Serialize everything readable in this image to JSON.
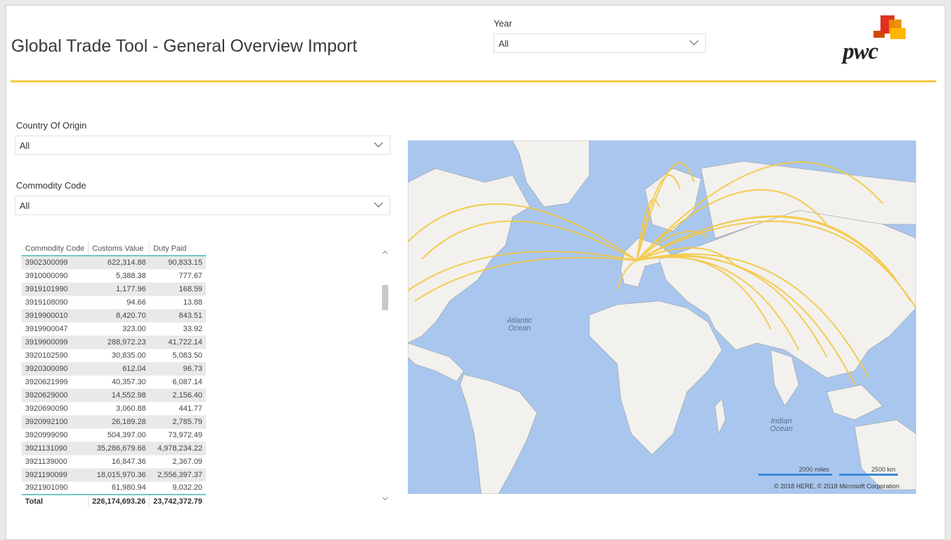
{
  "header": {
    "title": "Global Trade Tool - General Overview Import",
    "logo_text": "pwc"
  },
  "filters": {
    "year": {
      "label": "Year",
      "value": "All"
    },
    "country": {
      "label": "Country Of Origin",
      "value": "All"
    },
    "commodity": {
      "label": "Commodity Code",
      "value": "All"
    }
  },
  "table": {
    "columns": [
      "Commodity Code",
      "Customs Value",
      "Duty Paid"
    ],
    "rows": [
      [
        "3902300099",
        "622,314.88",
        "90,833.15"
      ],
      [
        "3910000090",
        "5,388.38",
        "777.67"
      ],
      [
        "3919101990",
        "1,177.96",
        "168.59"
      ],
      [
        "3919108090",
        "94.66",
        "13.88"
      ],
      [
        "3919900010",
        "8,420.70",
        "843.51"
      ],
      [
        "3919900047",
        "323.00",
        "33.92"
      ],
      [
        "3919900099",
        "288,972.23",
        "41,722.14"
      ],
      [
        "3920102590",
        "30,835.00",
        "5,083.50"
      ],
      [
        "3920300090",
        "612.04",
        "96.73"
      ],
      [
        "3920621999",
        "40,357.30",
        "6,087.14"
      ],
      [
        "3920629000",
        "14,552.98",
        "2,156.40"
      ],
      [
        "3920690090",
        "3,060.88",
        "441.77"
      ],
      [
        "3920992100",
        "26,189.28",
        "2,785.79"
      ],
      [
        "3920999090",
        "504,397.00",
        "73,972.49"
      ],
      [
        "3921131090",
        "35,286,679.66",
        "4,978,234.22"
      ],
      [
        "3921139000",
        "16,847.36",
        "2,367.09"
      ],
      [
        "3921190099",
        "18,015,970.36",
        "2,556,397.37"
      ],
      [
        "3921901090",
        "61,980.94",
        "9,032.20"
      ]
    ],
    "total": [
      "Total",
      "226,174,693.26",
      "23,742,372.79"
    ]
  },
  "map": {
    "labels": {
      "atlantic": "Atlantic\nOcean",
      "indian": "Indian\nOcean"
    },
    "scale_miles": "2000 miles",
    "scale_km": "2500 km",
    "copyright": "© 2018 HERE, © 2018 Microsoft Corporation",
    "route_color": "#f5c842"
  }
}
